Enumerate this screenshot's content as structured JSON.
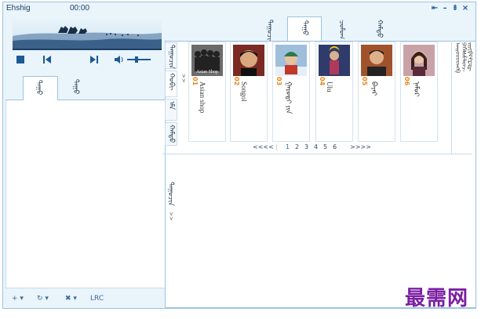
{
  "window": {
    "title": "Ehshig",
    "time": "00:00",
    "controls": [
      "⇤",
      "–",
      "⇟",
      "×"
    ]
  },
  "left": {
    "tabs": [
      {
        "label": "ᠳᠠᠭᠤ",
        "active": true
      },
      {
        "label": "ᠳᠠᠭᠤ",
        "active": false
      }
    ],
    "bottom_buttons": [
      {
        "icon": "add-icon",
        "glyph": "+ ▾"
      },
      {
        "icon": "repeat-icon",
        "glyph": "↻ ▾"
      },
      {
        "icon": "delete-icon",
        "glyph": "✖ ▾"
      },
      {
        "label": "LRC"
      }
    ]
  },
  "top_tabs": [
    {
      "label": "ᠳᠠᠭᠤᠴᠢᠨ ᠤ",
      "active": false
    },
    {
      "label": "ᠳᠠᠭᠤ",
      "active": true
    },
    {
      "label": "ᠴᠣᠮᠣᠭ",
      "active": false
    },
    {
      "label": "ᠬᠠᠮᠲᠤ",
      "active": false
    }
  ],
  "side_nav": [
    {
      "label": "ᠳᠠᠭᠤᠴᠢᠨ",
      "active": false
    },
    {
      "label": "ᠬᠣᠪᠢ",
      "active": true
    },
    {
      "label": "ᠡᠮᠡ",
      "active": false
    },
    {
      "label": "ᠬᠠᠮᠲᠤ",
      "active": false
    }
  ],
  "lower_label": "ᠳᠠᠭᠤᠴᠢᠨ",
  "more_marker": ">>",
  "artists": [
    {
      "num": "01",
      "name": "Asian shop",
      "photo_text": "Asian Shop",
      "bg": "#5a5a5a"
    },
    {
      "num": "02",
      "name": "Songol",
      "photo_text": "",
      "bg": "#7a2a22"
    },
    {
      "num": "03",
      "name": "ᠭᠠᠷᠤᠳᠢ ᠶᠢᠨ",
      "photo_text": "",
      "bg": "#7f9fbf"
    },
    {
      "num": "04",
      "name": "Ulu",
      "photo_text": "",
      "bg": "#2e3b6b"
    },
    {
      "num": "05",
      "name": "ᠪᠠᠶᠠᠷ",
      "photo_text": "",
      "bg": "#a0522d"
    },
    {
      "num": "06",
      "name": "ᠨᠠᠮᠤᠷ",
      "photo_text": "",
      "bg": "#c9a2a8"
    }
  ],
  "pager": {
    "prev": "<<<<",
    "pages": [
      "1",
      "2",
      "3",
      "4",
      "5",
      "6"
    ],
    "next": ">>>>"
  },
  "alphabet_lines": [
    "ᠠᠡᠢᠣᠤᠥᠦᠨᠩᠪ",
    "ᠫᠬᠭᠮᠯᠰᠱᠲᠳᠴ",
    "ᠵᠶᠷᠸᠹᠺᠻᠼᠽᠾ"
  ],
  "watermark": "最需网",
  "colors": {
    "accent": "#1b5a95",
    "number": "#e8861a",
    "watermark": "#7b1fa2"
  }
}
